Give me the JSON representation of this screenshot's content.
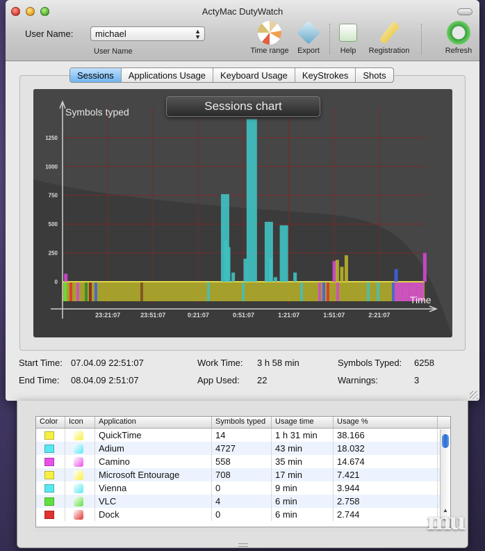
{
  "window": {
    "title": "ActyMac DutyWatch"
  },
  "user": {
    "label": "User Name:",
    "value": "michael",
    "sublabel": "User Name"
  },
  "toolbar": {
    "time_range": "Time range",
    "export": "Export",
    "help": "Help",
    "registration": "Registration",
    "refresh": "Refresh"
  },
  "tabs": [
    "Sessions",
    "Applications Usage",
    "Keyboard Usage",
    "KeyStrokes",
    "Shots"
  ],
  "active_tab": "Sessions",
  "chart_data": {
    "type": "bar",
    "title": "Sessions chart",
    "ylabel": "Symbols typed",
    "xlabel": "Time",
    "yticks": [
      0,
      250,
      500,
      750,
      1000,
      1250
    ],
    "xticks": [
      "23:21:07",
      "23:51:07",
      "0:21:07",
      "0:51:07",
      "1:21:07",
      "1:51:07",
      "2:21:07"
    ],
    "ylim": [
      0,
      1400
    ],
    "grid": true,
    "colors": {
      "background": "#3b3b3b",
      "grid": "#7a2a2a",
      "axis": "#cfcfcf",
      "baseline_band": "#b8b12a",
      "baseline_line": "#e0d848"
    },
    "bars": [
      {
        "t": "22:52",
        "value": 70,
        "color": "#d048d0"
      },
      {
        "t": "0:36",
        "value": 760,
        "color": "#40c0c0"
      },
      {
        "t": "0:38",
        "value": 360,
        "color": "#40c0c0"
      },
      {
        "t": "0:40",
        "value": 300,
        "color": "#40c0c0"
      },
      {
        "t": "0:43",
        "value": 80,
        "color": "#40c0c0"
      },
      {
        "t": "0:51",
        "value": 200,
        "color": "#40c0c0"
      },
      {
        "t": "0:53",
        "value": 1410,
        "color": "#40c0c0"
      },
      {
        "t": "1:05",
        "value": 520,
        "color": "#40c0c0"
      },
      {
        "t": "1:08",
        "value": 200,
        "color": "#40c0c0"
      },
      {
        "t": "1:11",
        "value": 40,
        "color": "#40c0c0"
      },
      {
        "t": "1:15",
        "value": 490,
        "color": "#40c0c0"
      },
      {
        "t": "1:24",
        "value": 80,
        "color": "#40c0c0"
      },
      {
        "t": "1:50",
        "value": 180,
        "color": "#d048d0"
      },
      {
        "t": "1:52",
        "value": 190,
        "color": "#b8b12a"
      },
      {
        "t": "1:55",
        "value": 130,
        "color": "#b8b12a"
      },
      {
        "t": "1:58",
        "value": 230,
        "color": "#b8b12a"
      },
      {
        "t": "2:31",
        "value": 110,
        "color": "#4060e0"
      },
      {
        "t": "2:50",
        "value": 250,
        "color": "#d048d0"
      }
    ]
  },
  "stats": {
    "start_time_label": "Start Time:",
    "start_time": "07.04.09 22:51:07",
    "end_time_label": "End Time:",
    "end_time": "08.04.09 2:51:07",
    "work_time_label": "Work Time:",
    "work_time": "3 h 58 min",
    "app_used_label": "App Used:",
    "app_used": "22",
    "symbols_label": "Symbols Typed:",
    "symbols": "6258",
    "warnings_label": "Warnings:",
    "warnings": "3"
  },
  "table": {
    "columns": [
      "Color",
      "Icon",
      "Application",
      "Symbols typed",
      "Usage time",
      "Usage %"
    ],
    "rows": [
      {
        "color": "#f8f040",
        "icon": "quicktime-icon",
        "app": "QuickTime",
        "symbols": "14",
        "time": "1 h 31 min",
        "pct": "38.166"
      },
      {
        "color": "#58e8f0",
        "icon": "adium-icon",
        "app": "Adium",
        "symbols": "4727",
        "time": "43 min",
        "pct": "18.032"
      },
      {
        "color": "#e850e8",
        "icon": "camino-icon",
        "app": "Camino",
        "symbols": "558",
        "time": "35 min",
        "pct": "14.674"
      },
      {
        "color": "#f8f040",
        "icon": "entourage-icon",
        "app": "Microsoft Entourage",
        "symbols": "708",
        "time": "17 min",
        "pct": "7.421"
      },
      {
        "color": "#58e8f0",
        "icon": "vienna-icon",
        "app": "Vienna",
        "symbols": "0",
        "time": "9 min",
        "pct": "3.944"
      },
      {
        "color": "#60e040",
        "icon": "vlc-icon",
        "app": "VLC",
        "symbols": "4",
        "time": "6 min",
        "pct": "2.758"
      },
      {
        "color": "#e03030",
        "icon": "dock-icon",
        "app": "Dock",
        "symbols": "0",
        "time": "6 min",
        "pct": "2.744"
      }
    ]
  },
  "watermark": "mu"
}
